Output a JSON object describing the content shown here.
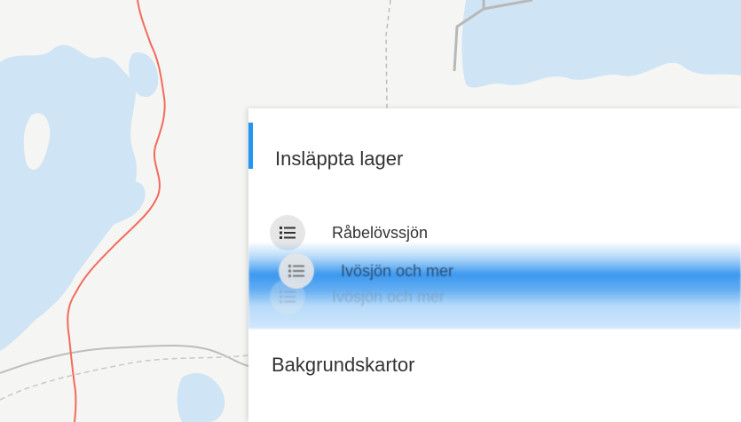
{
  "layers_panel": {
    "title": "Insläppta lager",
    "layers": [
      {
        "label": "Råbelövssjön",
        "icon": "list-icon"
      },
      {
        "label": "Ivösjön och mer",
        "icon": "list-icon"
      }
    ],
    "ghost_label": "Ivösjön och mer",
    "accent_color": "#2196f3",
    "drag_highlight_color": "#3c98ef"
  },
  "basemaps_section": {
    "title": "Bakgrundskartor"
  },
  "map": {
    "water_color": "#cfe4f5",
    "land_color": "#f5f5f3",
    "border_color": "#f26b5b",
    "road_color": "#b8b8b8"
  }
}
